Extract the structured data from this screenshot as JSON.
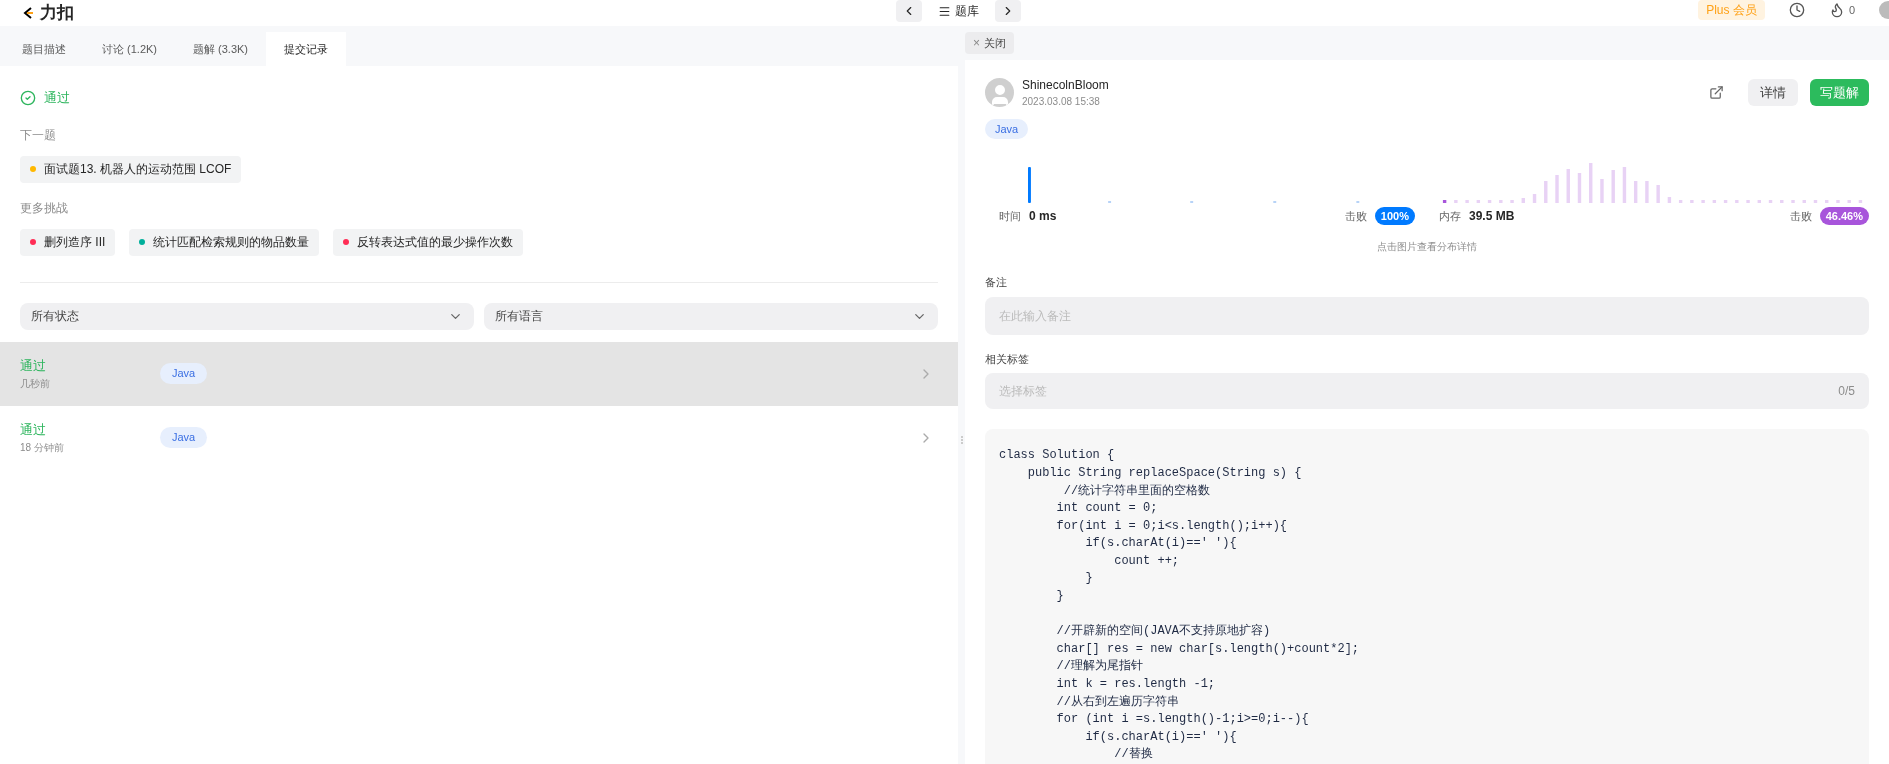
{
  "topbar": {
    "logo": "力扣",
    "nav_label": "题库",
    "plus": "Plus 会员",
    "streak": "0"
  },
  "tabs": [
    {
      "label": "题目描述",
      "selected": false
    },
    {
      "label": "讨论 (1.2K)",
      "selected": false
    },
    {
      "label": "题解 (3.3K)",
      "selected": false
    },
    {
      "label": "提交记录",
      "selected": true
    }
  ],
  "result": {
    "status": "通过",
    "next_label": "下一题",
    "next": {
      "title": "面试题13. 机器人的运动范围 LCOF",
      "color": "#ffb800"
    },
    "more_label": "更多挑战",
    "challenges": [
      {
        "title": "删列造序 III",
        "color": "#ff2d55"
      },
      {
        "title": "统计匹配检索规则的物品数量",
        "color": "#00af9b"
      },
      {
        "title": "反转表达式值的最少操作次数",
        "color": "#ff2d55"
      }
    ]
  },
  "filters": [
    {
      "value": "所有状态"
    },
    {
      "value": "所有语言"
    }
  ],
  "submissions": [
    {
      "status": "通过",
      "time": "几秒前",
      "language": "Java",
      "selected": true
    },
    {
      "status": "通过",
      "time": "18 分钟前",
      "language": "Java",
      "selected": false
    }
  ],
  "detail_tab": {
    "close_icon": "×",
    "label": "关闭"
  },
  "detail": {
    "user": "ShinecolnBloom",
    "date": "2023.03.08 15:38",
    "details_button": "详情",
    "write_button": "写题解",
    "language": "Java",
    "runtime": {
      "label": "时间",
      "value": "0 ms",
      "beat_label": "击败",
      "beat": "100%"
    },
    "memory": {
      "label": "内存",
      "value": "39.5 MB",
      "beat_label": "击败",
      "beat": "46.46%"
    },
    "hint": "点击图片查看分布详情",
    "note": {
      "label": "备注",
      "placeholder": "在此输入备注"
    },
    "tags": {
      "label": "相关标签",
      "placeholder": "选择标签",
      "count": "0/5"
    },
    "code": "class Solution {\n    public String replaceSpace(String s) {\n         //统计字符串里面的空格数\n        int count = 0;\n        for(int i = 0;i<s.length();i++){\n            if(s.charAt(i)==' '){\n                count ++;\n            }\n        }\n\n        //开辟新的空间(JAVA不支持原地扩容)\n        char[] res = new char[s.length()+count*2];\n        //理解为尾指针\n        int k = res.length -1;\n        //从右到左遍历字符串\n        for (int i =s.length()-1;i>=0;i--){\n            if(s.charAt(i)==' '){\n                //替换"
  }
}
